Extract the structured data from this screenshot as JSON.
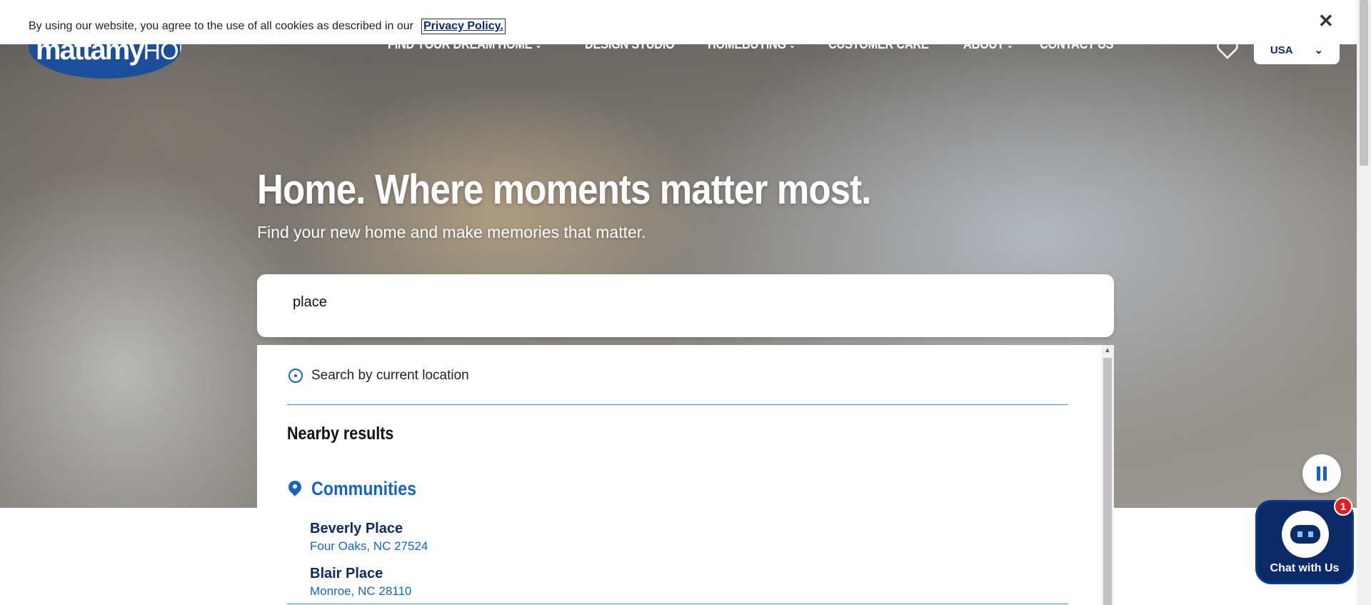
{
  "cookie_bar": {
    "text": "By using our website, you agree to the use of all cookies as described in our",
    "link": "Privacy Policy.",
    "close_glyph": "✕"
  },
  "brand": {
    "logo_text_1": "mattamy",
    "logo_text_2": "HOMES",
    "color": "#1b4e9b"
  },
  "nav": {
    "items": [
      {
        "label": "FIND YOUR DREAM HOME",
        "has_dropdown": true
      },
      {
        "label": "DESIGN STUDIO",
        "has_dropdown": false
      },
      {
        "label": "HOMEBUYING",
        "has_dropdown": true
      },
      {
        "label": "CUSTOMER CARE",
        "has_dropdown": false
      },
      {
        "label": "ABOUT",
        "has_dropdown": true
      },
      {
        "label": "CONTACT US",
        "has_dropdown": false
      }
    ],
    "chevron": "⌄",
    "heart_icon": "heart-icon",
    "country": "USA"
  },
  "hero": {
    "headline": "Home. Where moments matter most.",
    "subheadline": "Find your new home and make memories that matter."
  },
  "search": {
    "value": "place",
    "placeholder": ""
  },
  "dropdown": {
    "current_location_label": "Search by current location",
    "nearby_heading": "Nearby results",
    "communities_heading": "Communities",
    "results": [
      {
        "name": "Beverly Place",
        "address": "Four Oaks, NC 27524"
      },
      {
        "name": "Blair Place",
        "address": "Monroe, NC 28110"
      }
    ]
  },
  "chat": {
    "label": "Chat with Us",
    "badge_count": "1"
  },
  "colors": {
    "accent": "#1565c0",
    "navy": "#0b2a66",
    "divider": "#3aa0b8",
    "badge": "#e02020"
  }
}
